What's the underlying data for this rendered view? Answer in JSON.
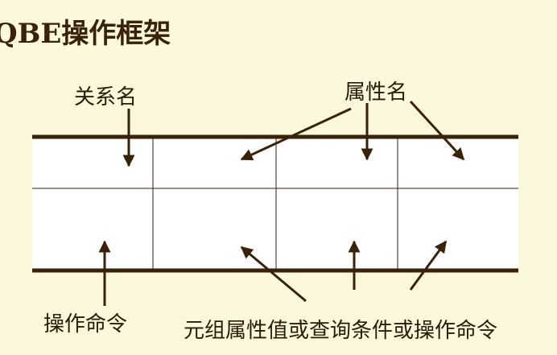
{
  "title": "QBE操作框架",
  "labels": {
    "relation_name": "关系名",
    "attribute_name": "属性名",
    "operation_command": "操作命令",
    "tuple_values": "元组属性值或查询条件或操作命令"
  },
  "colors": {
    "background": "#fcf8dc",
    "table_fill": "#ffffff",
    "frame": "#3a2208"
  },
  "table": {
    "columns": 4,
    "rows": 2
  }
}
